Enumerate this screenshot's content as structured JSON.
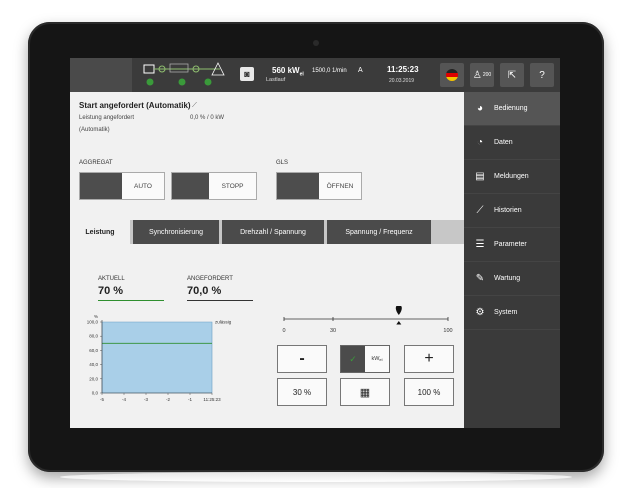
{
  "header": {
    "power_value": "560 kW",
    "power_sub": "el",
    "power_mode": "Lastlauf",
    "rpm": "1500,0",
    "rpm_unit": "1/min",
    "ampere": "A",
    "time": "11:25:23",
    "date": "20.03.2019",
    "users_count": "200"
  },
  "sidebar": {
    "items": [
      {
        "label": "Bedienung",
        "icon": "dial-icon"
      },
      {
        "label": "Daten",
        "icon": "gauge-icon"
      },
      {
        "label": "Meldungen",
        "icon": "list-icon"
      },
      {
        "label": "Historien",
        "icon": "chart-icon"
      },
      {
        "label": "Parameter",
        "icon": "sliders-icon"
      },
      {
        "label": "Wartung",
        "icon": "wrench-icon"
      },
      {
        "label": "System",
        "icon": "gears-icon"
      }
    ]
  },
  "status": {
    "title": "Start angefordert (Automatik)",
    "line1": "Leistung angefordert",
    "line2": "(Automatik)",
    "value": "0,0 % / 0 kW"
  },
  "aggregat": {
    "label": "AGGREGAT",
    "opt1": "",
    "opt2": "AUTO",
    "opt3": "",
    "opt4": "STOPP"
  },
  "gls": {
    "label": "GLS",
    "opt1": "",
    "opt2": "ÖFFNEN"
  },
  "tabs": [
    "Leistung",
    "Synchronisierung",
    "Drehzahl / Spannung",
    "Spannung / Frequenz"
  ],
  "values": {
    "actual_label": "AKTUELL",
    "actual_value": "70 %",
    "requested_label": "ANGEFORDERT",
    "requested_value": "70,0 %"
  },
  "slider": {
    "min_label": "0",
    "mid_label": "30",
    "max_label": "100",
    "value": 70
  },
  "controls": {
    "minus": "-",
    "unit": "kW",
    "unit_sub": "el",
    "plus": "+",
    "preset_low": "30 %",
    "preset_high": "100 %"
  },
  "chart_data": {
    "type": "area",
    "ylabel": "%",
    "yticks": [
      "100,0",
      "80,0",
      "60,0",
      "40,0",
      "20,0",
      "0,0"
    ],
    "xticks": [
      "-5",
      "-4",
      "-3",
      "-2",
      "-1",
      "11:25:23"
    ],
    "ylim": [
      0,
      100
    ],
    "series": [
      {
        "name": "",
        "values": [
          100,
          100,
          100,
          100,
          100,
          100
        ]
      },
      {
        "name": "zulässig",
        "values": [
          70,
          70,
          70,
          70,
          70,
          70
        ]
      }
    ],
    "annotation": "zulässig",
    "colors": {
      "fill": "#a9cfe8",
      "line": "#2f8f2f"
    }
  }
}
